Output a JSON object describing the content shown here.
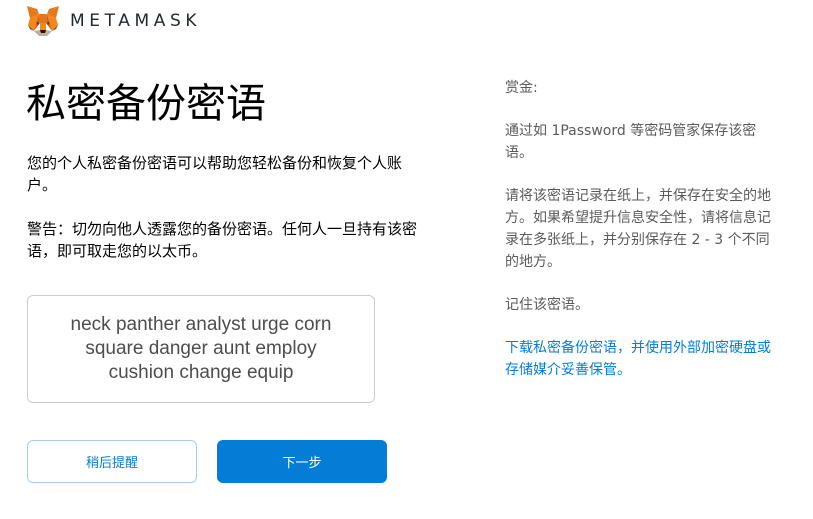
{
  "header": {
    "brand": "METAMASK"
  },
  "main": {
    "title": "私密备份密语",
    "description": "您的个人私密备份密语可以帮助您轻松备份和恢复个人账户。",
    "warning": "警告：切勿向他人透露您的备份密语。任何人一旦持有该密语，即可取走您的以太币。",
    "secret_phrase": "neck panther analyst urge corn square danger aunt employ cushion change equip",
    "buttons": {
      "remind_later": "稍后提醒",
      "next": "下一步"
    }
  },
  "tips": {
    "title": "赏金:",
    "tip_password_manager": "通过如 1Password 等密码管家保存该密语。",
    "tip_paper": "请将该密语记录在纸上，并保存在安全的地方。如果希望提升信息安全性，请将信息记录在多张纸上，并分别保存在 2 - 3 个不同的地方。",
    "tip_memorize": "记住该密语。",
    "download_link": "下载私密备份密语，并使用外部加密硬盘或存储媒介妥善保管。"
  },
  "colors": {
    "accent": "#037dd6",
    "button_border": "#a8cdec",
    "box_border": "#cdcdcd",
    "fox_orange": "#e2761b"
  },
  "icons": {
    "logo": "metamask-fox-icon"
  }
}
